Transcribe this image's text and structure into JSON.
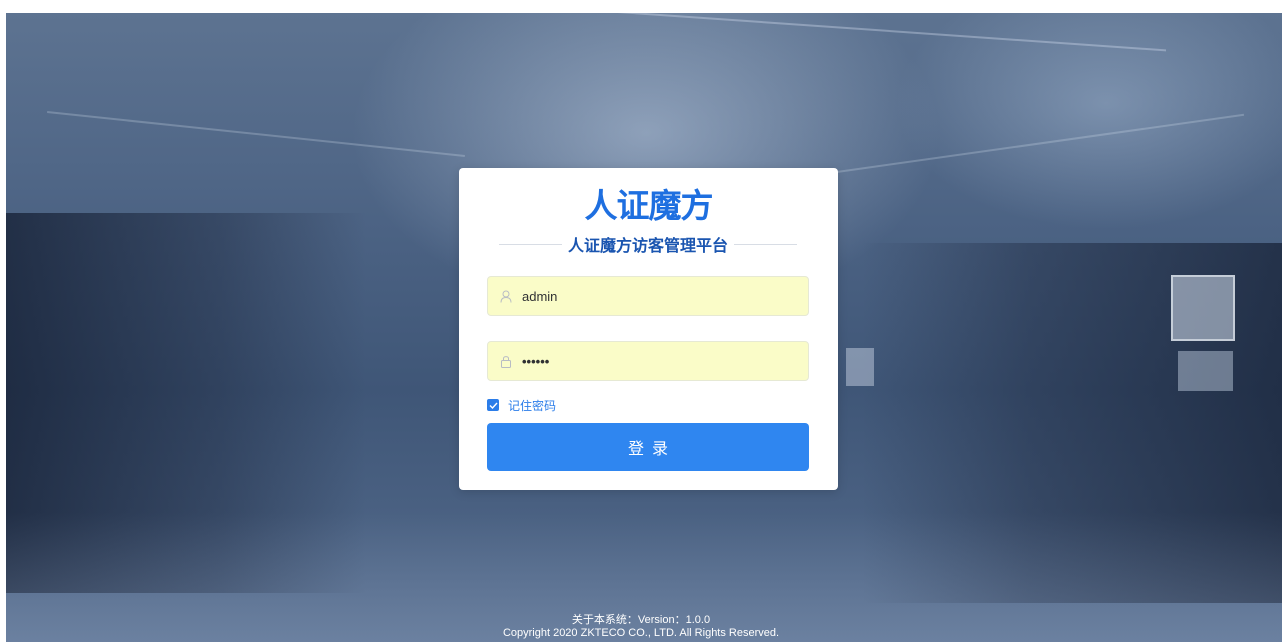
{
  "brand": {
    "logo_text": "人证魔方",
    "subtitle": "人证魔方访客管理平台",
    "accent_color": "#2f86f0"
  },
  "form": {
    "username_value": "admin",
    "password_value": "••••••",
    "remember_label": "记住密码",
    "remember_checked": true,
    "login_label": "登录",
    "user_icon": "user-icon",
    "lock_icon": "lock-icon"
  },
  "footer": {
    "version_line": "关于本系统：Version：1.0.0",
    "copyright_line": "Copyright 2020 ZKTECO CO., LTD. All Rights Reserved."
  }
}
